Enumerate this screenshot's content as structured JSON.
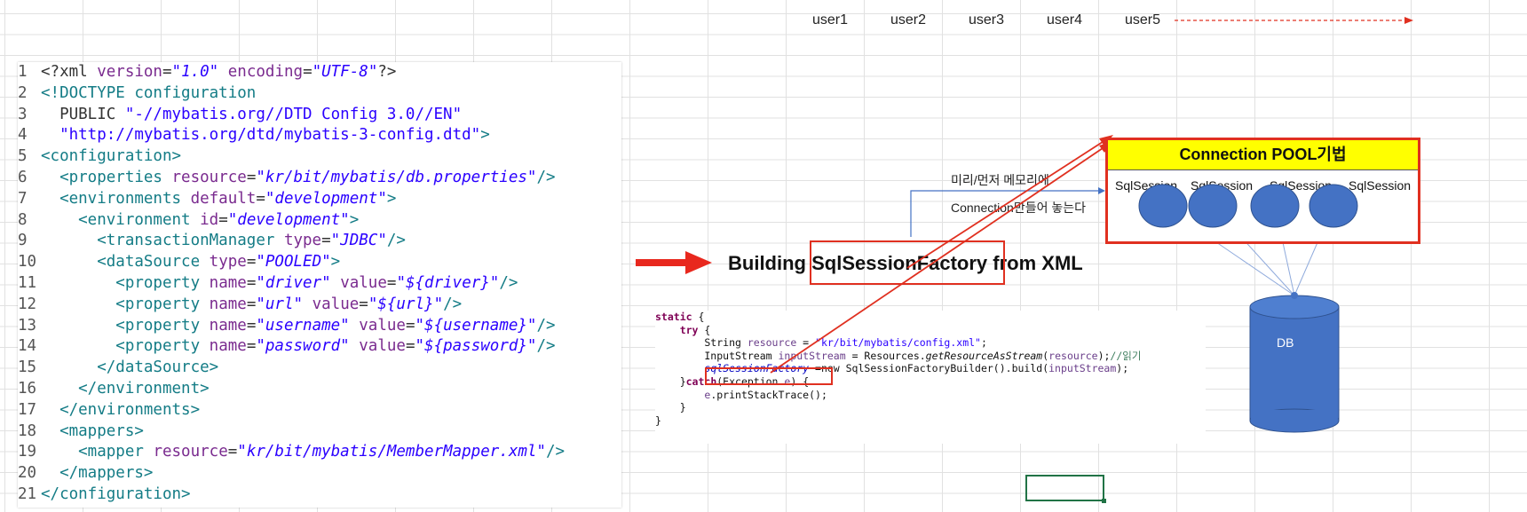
{
  "users": [
    "user1",
    "user2",
    "user3",
    "user4",
    "user5"
  ],
  "xml_code": [
    [
      [
        "pl",
        "<?xml "
      ],
      [
        "attr",
        "version"
      ],
      [
        "pl",
        "="
      ],
      [
        "val",
        "\"1.0\""
      ],
      [
        "pl",
        " "
      ],
      [
        "attr",
        "encoding"
      ],
      [
        "pl",
        "="
      ],
      [
        "val",
        "\"UTF-8\""
      ],
      [
        "pl",
        "?>"
      ]
    ],
    [
      [
        "tag",
        "<!DOCTYPE configuration"
      ]
    ],
    [
      [
        "pl",
        "  PUBLIC "
      ],
      [
        "str",
        "\"-//mybatis.org//DTD Config 3.0//EN\""
      ]
    ],
    [
      [
        "pl",
        "  "
      ],
      [
        "str",
        "\"http://mybatis.org/dtd/mybatis-3-config.dtd\""
      ],
      [
        "tag",
        ">"
      ]
    ],
    [
      [
        "tag",
        "<configuration>"
      ]
    ],
    [
      [
        "tag",
        "  <properties "
      ],
      [
        "attr",
        "resource"
      ],
      [
        "pl",
        "="
      ],
      [
        "val",
        "\"kr/bit/mybatis/db.properties\""
      ],
      [
        "tag",
        "/>"
      ]
    ],
    [
      [
        "tag",
        "  <environments "
      ],
      [
        "attr",
        "default"
      ],
      [
        "pl",
        "="
      ],
      [
        "val",
        "\"development\""
      ],
      [
        "tag",
        ">"
      ]
    ],
    [
      [
        "tag",
        "    <environment "
      ],
      [
        "attr",
        "id"
      ],
      [
        "pl",
        "="
      ],
      [
        "val",
        "\"development\""
      ],
      [
        "tag",
        ">"
      ]
    ],
    [
      [
        "tag",
        "      <transactionManager "
      ],
      [
        "attr",
        "type"
      ],
      [
        "pl",
        "="
      ],
      [
        "val",
        "\"JDBC\""
      ],
      [
        "tag",
        "/>"
      ]
    ],
    [
      [
        "tag",
        "      <dataSource "
      ],
      [
        "attr",
        "type"
      ],
      [
        "pl",
        "="
      ],
      [
        "val",
        "\"POOLED\""
      ],
      [
        "tag",
        ">"
      ]
    ],
    [
      [
        "tag",
        "        <property "
      ],
      [
        "attr",
        "name"
      ],
      [
        "pl",
        "="
      ],
      [
        "val",
        "\"driver\""
      ],
      [
        "pl",
        " "
      ],
      [
        "attr",
        "value"
      ],
      [
        "pl",
        "="
      ],
      [
        "val",
        "\"${driver}\""
      ],
      [
        "tag",
        "/>"
      ]
    ],
    [
      [
        "tag",
        "        <property "
      ],
      [
        "attr",
        "name"
      ],
      [
        "pl",
        "="
      ],
      [
        "val",
        "\"url\""
      ],
      [
        "pl",
        " "
      ],
      [
        "attr",
        "value"
      ],
      [
        "pl",
        "="
      ],
      [
        "val",
        "\"${url}\""
      ],
      [
        "tag",
        "/>"
      ]
    ],
    [
      [
        "tag",
        "        <property "
      ],
      [
        "attr",
        "name"
      ],
      [
        "pl",
        "="
      ],
      [
        "val",
        "\"username\""
      ],
      [
        "pl",
        " "
      ],
      [
        "attr",
        "value"
      ],
      [
        "pl",
        "="
      ],
      [
        "val",
        "\"${username}\""
      ],
      [
        "tag",
        "/>"
      ]
    ],
    [
      [
        "tag",
        "        <property "
      ],
      [
        "attr",
        "name"
      ],
      [
        "pl",
        "="
      ],
      [
        "val",
        "\"password\""
      ],
      [
        "pl",
        " "
      ],
      [
        "attr",
        "value"
      ],
      [
        "pl",
        "="
      ],
      [
        "val",
        "\"${password}\""
      ],
      [
        "tag",
        "/>"
      ]
    ],
    [
      [
        "tag",
        "      </dataSource>"
      ]
    ],
    [
      [
        "tag",
        "    </environment>"
      ]
    ],
    [
      [
        "tag",
        "  </environments>"
      ]
    ],
    [
      [
        "tag",
        "  <mappers>"
      ]
    ],
    [
      [
        "tag",
        "    <mapper "
      ],
      [
        "attr",
        "resource"
      ],
      [
        "pl",
        "="
      ],
      [
        "val",
        "\"kr/bit/mybatis/MemberMapper.xml\""
      ],
      [
        "tag",
        "/>"
      ]
    ],
    [
      [
        "tag",
        "  </mappers>"
      ]
    ],
    [
      [
        "tag",
        "</configuration>"
      ]
    ]
  ],
  "heading": {
    "prefix": "Building ",
    "highlight": "SqlSessionFactory",
    "suffix": " from XML"
  },
  "note_line1": "미리/먼저 메모리에",
  "note_line2": "Connection만들어 놓는다",
  "java_code": [
    [
      [
        "kw",
        "static"
      ],
      [
        "pl",
        " {"
      ]
    ],
    [
      [
        "pl",
        "    "
      ],
      [
        "kw",
        "try"
      ],
      [
        "pl",
        " {"
      ]
    ],
    [
      [
        "pl",
        "        String "
      ],
      [
        "var",
        "resource"
      ],
      [
        "pl",
        " = "
      ],
      [
        "str",
        "\"kr/bit/mybatis/config.xml\""
      ],
      [
        "pl",
        ";"
      ]
    ],
    [
      [
        "pl",
        "        InputStream "
      ],
      [
        "var",
        "inputStream"
      ],
      [
        "pl",
        " = Resources."
      ],
      [
        "it",
        "getResourceAsStream"
      ],
      [
        "pl",
        "("
      ],
      [
        "var",
        "resource"
      ],
      [
        "pl",
        ");"
      ],
      [
        "cmt",
        "//읽기"
      ]
    ],
    [
      [
        "pl",
        "        "
      ],
      [
        "field",
        "sqlSessionFactory"
      ],
      [
        "pl",
        " =new SqlSessionFactoryBuilder().build("
      ],
      [
        "var",
        "inputStream"
      ],
      [
        "pl",
        ");"
      ]
    ],
    [
      [
        "pl",
        "    }"
      ],
      [
        "kw",
        "catch"
      ],
      [
        "pl",
        "(Exception "
      ],
      [
        "var",
        "e"
      ],
      [
        "pl",
        ") {"
      ]
    ],
    [
      [
        "pl",
        "        "
      ],
      [
        "var",
        "e"
      ],
      [
        "pl",
        ".printStackTrace();"
      ]
    ],
    [
      [
        "pl",
        "    }"
      ]
    ],
    [
      [
        "pl",
        "}"
      ]
    ]
  ],
  "pool": {
    "title": "Connection POOL기법",
    "sessions": [
      "SqlSession",
      "SqlSession",
      "SqlSession",
      "SqlSession"
    ]
  },
  "db_label": "DB",
  "colors": {
    "accent_red": "#e03020",
    "pool_header": "#ffff00",
    "circle_fill": "#4472c4",
    "selection_green": "#217346"
  }
}
